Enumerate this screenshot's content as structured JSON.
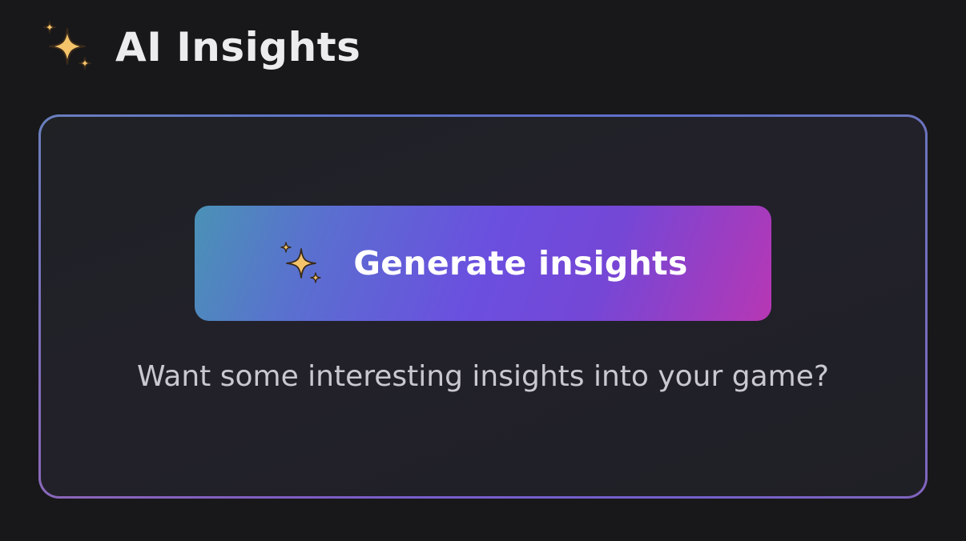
{
  "header": {
    "icon": "sparkles-icon",
    "title": "AI Insights"
  },
  "card": {
    "button": {
      "icon": "sparkles-icon",
      "label": "Generate insights"
    },
    "subtitle": "Want some interesting insights into your game?"
  },
  "colors": {
    "background": "#18181a",
    "sparkle": "#f5c46a",
    "button_gradient_start": "#4a92b6",
    "button_gradient_mid": "#6b4fdf",
    "button_gradient_end": "#b737b4",
    "text_primary": "#ececee",
    "text_secondary": "#c9c8d0"
  }
}
